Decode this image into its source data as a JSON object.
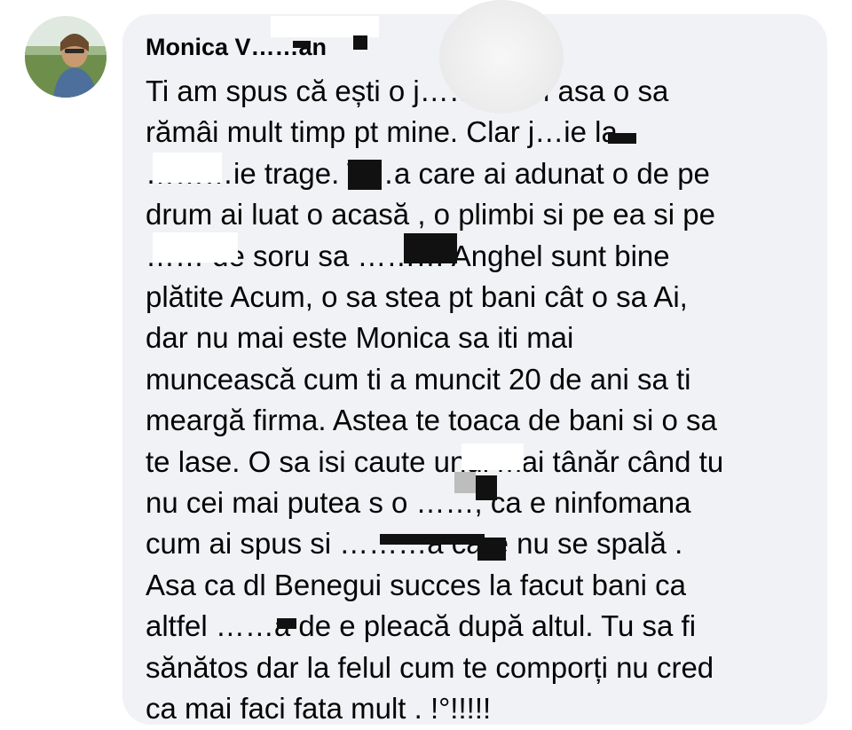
{
  "comment": {
    "author": "Monica V……an",
    "lines": [
      "Ti am spus că ești o j………. Si asa o sa",
      "rămâi mult timp pt mine. Clar j…ie la",
      "………ie trage. T…a care ai adunat o de pe",
      "drum ai luat o acasă , o plimbi si pe ea si pe",
      "…… de soru sa ……… Anghel sunt bine",
      "plătite Acum, o sa stea pt bani cât o sa Ai,",
      "dar nu mai este Monica sa iti mai",
      "muncească cum ti a muncit 20 de ani sa ti",
      "meargă firma. Astea te toaca de bani si o sa",
      "te lase. O sa isi caute unul mai tânăr când tu",
      "nu cei mai putea s o ……, ca e ninfomana",
      "cum ai spus si ………a care nu se spală .",
      "Asa ca dl Benegui succes la facut bani ca",
      "altfel ……a de e pleacă după altul. Tu sa fi",
      "sănătos dar la felul cum te comporți nu cred",
      "ca mai faci fata mult . !°!!!!!"
    ]
  }
}
